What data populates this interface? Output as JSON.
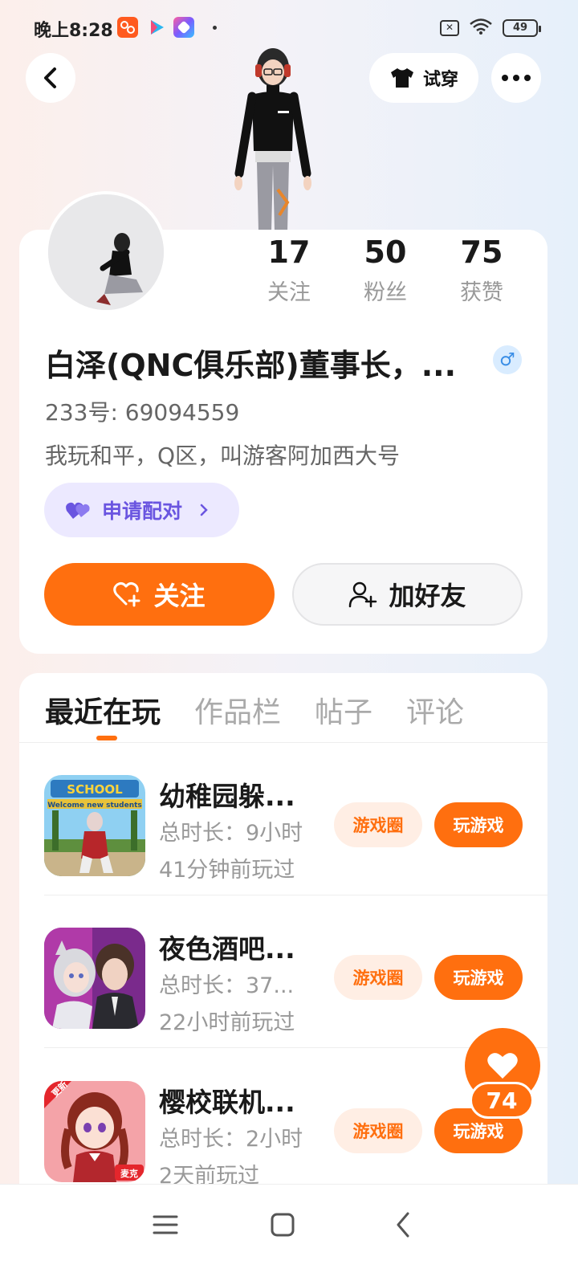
{
  "status_bar": {
    "time": "晚上8:28",
    "battery": "49",
    "app_icons": [
      "taobao-app-icon",
      "play-app-icon",
      "gallery-app-icon"
    ],
    "sim_icon": "sim-off-icon",
    "wifi_icon": "wifi-icon"
  },
  "header": {
    "back_icon": "back-icon",
    "tryon_label": "试穿",
    "tryon_icon": "shirt-icon",
    "more_icon": "more-icon"
  },
  "profile": {
    "stats": [
      {
        "value": "17",
        "label": "关注"
      },
      {
        "value": "50",
        "label": "粉丝"
      },
      {
        "value": "75",
        "label": "获赞"
      }
    ],
    "username": "白泽(QNC俱乐部)董事长，...",
    "gender_icon": "male-icon",
    "gender_symbol": "♂",
    "user_id": "233号: 69094559",
    "bio": "我玩和平，Q区，叫游客阿加西大号",
    "pair_label": "申请配对",
    "follow_label": "关注",
    "add_friend_label": "加好友"
  },
  "tabs": [
    {
      "label": "最近在玩",
      "active": true
    },
    {
      "label": "作品栏",
      "active": false
    },
    {
      "label": "帖子",
      "active": false
    },
    {
      "label": "评论",
      "active": false
    }
  ],
  "games": [
    {
      "title": "幼稚园躲...",
      "duration": "总时长：9小时",
      "last_played": "41分钟前玩过",
      "circle_label": "游戏圈",
      "play_label": "玩游戏"
    },
    {
      "title": "夜色酒吧...",
      "duration": "总时长：37...",
      "last_played": "22小时前玩过",
      "circle_label": "游戏圈",
      "play_label": "玩游戏"
    },
    {
      "title": "樱校联机...",
      "duration": "总时长：2小时",
      "last_played": "2天前玩过",
      "circle_label": "游戏圈",
      "play_label": "玩游戏"
    }
  ],
  "thumb_texts": {
    "school_sign": "SCHOOL",
    "welcome": "Welcome new students",
    "badge_new": "更新",
    "badge_maike": "麦克"
  },
  "like": {
    "count": "74",
    "icon": "heart-icon"
  },
  "nav": {
    "icons": [
      "menu-icon",
      "home-icon",
      "back-nav-icon"
    ]
  },
  "colors": {
    "accent": "#ff6f0f",
    "pair": "#6a55e0",
    "gender": "#3a8ee6"
  }
}
